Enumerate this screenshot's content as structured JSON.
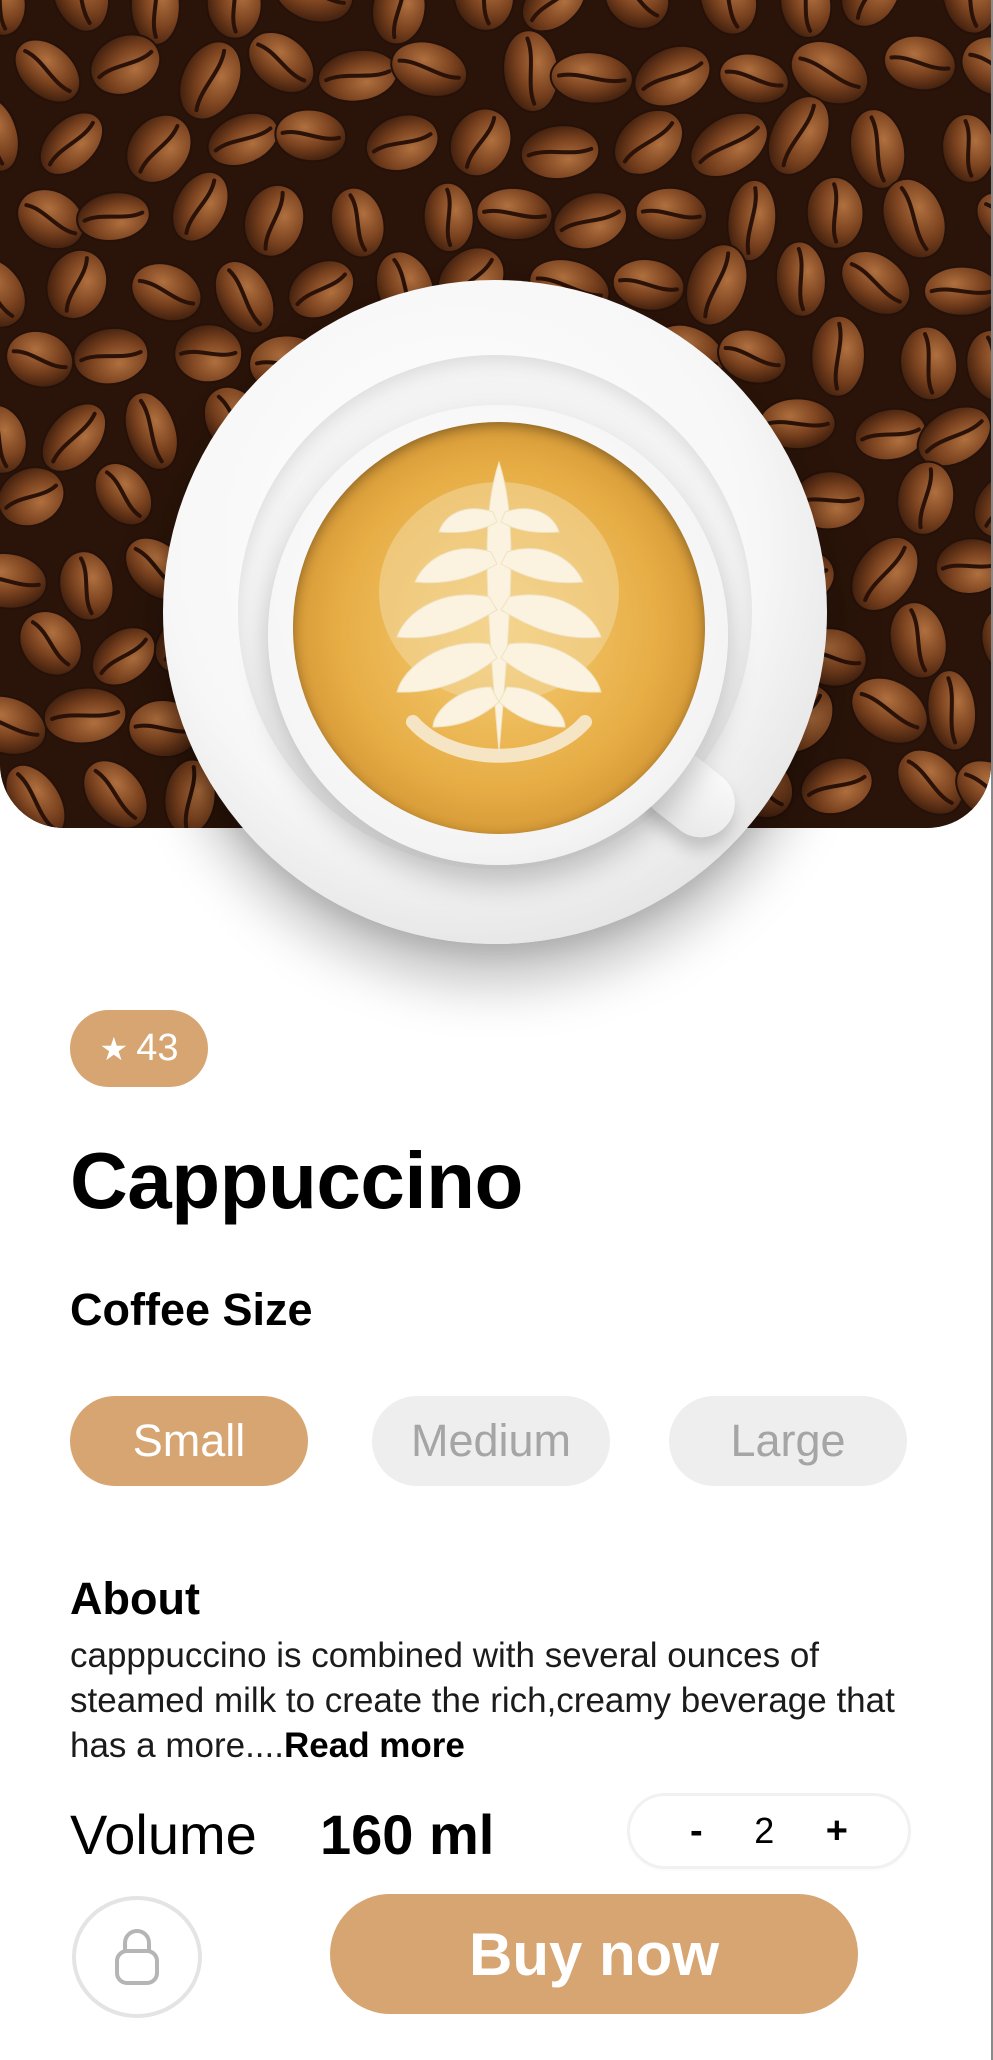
{
  "hero": {
    "image": "cappuccino-cup-on-coffee-beans"
  },
  "rating": {
    "icon": "star-icon",
    "value": "43"
  },
  "product": {
    "title": "Cappuccino"
  },
  "size_section": {
    "heading": "Coffee Size",
    "options": [
      {
        "label": "Small",
        "selected": true
      },
      {
        "label": "Medium",
        "selected": false
      },
      {
        "label": "Large",
        "selected": false
      }
    ]
  },
  "about": {
    "heading": "About",
    "text": "capppuccino is combined with several ounces of steamed milk to create the rich,creamy beverage that has a more....",
    "read_more": "Read more"
  },
  "volume": {
    "label": "Volume",
    "value": "160 ml"
  },
  "quantity": {
    "minus": "-",
    "value": "2",
    "plus": "+"
  },
  "actions": {
    "lock_icon": "lock-icon",
    "buy_label": "Buy now"
  },
  "colors": {
    "accent": "#d7a571",
    "inactive_bg": "#eeeeee",
    "inactive_text": "#a5a5a5"
  }
}
